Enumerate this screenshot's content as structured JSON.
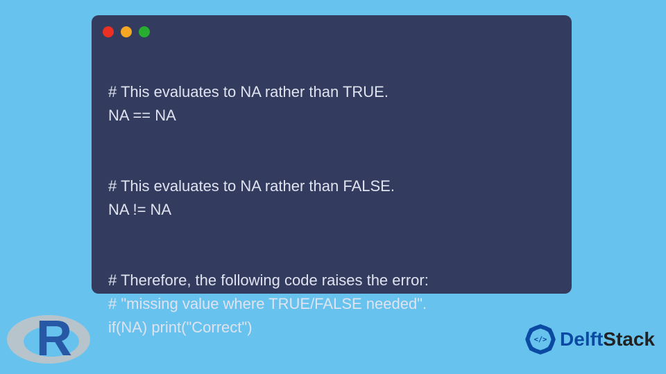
{
  "code": {
    "lines": [
      "# This evaluates to NA rather than TRUE.",
      "NA == NA",
      "",
      "# This evaluates to NA rather than FALSE.",
      "NA != NA",
      "",
      "# Therefore, the following code raises the error:",
      "# \"missing value where TRUE/FALSE needed\".",
      "if(NA) print(\"Correct\")"
    ]
  },
  "window": {
    "dots": [
      "red",
      "yellow",
      "green"
    ]
  },
  "logos": {
    "r_letter": "R",
    "brand_delft": "Delft",
    "brand_stack": "Stack"
  },
  "colors": {
    "page_bg": "#67c3ee",
    "card_bg": "#333C5E",
    "code_text": "#dfe2ef",
    "brand_primary": "#0b4aa2"
  }
}
